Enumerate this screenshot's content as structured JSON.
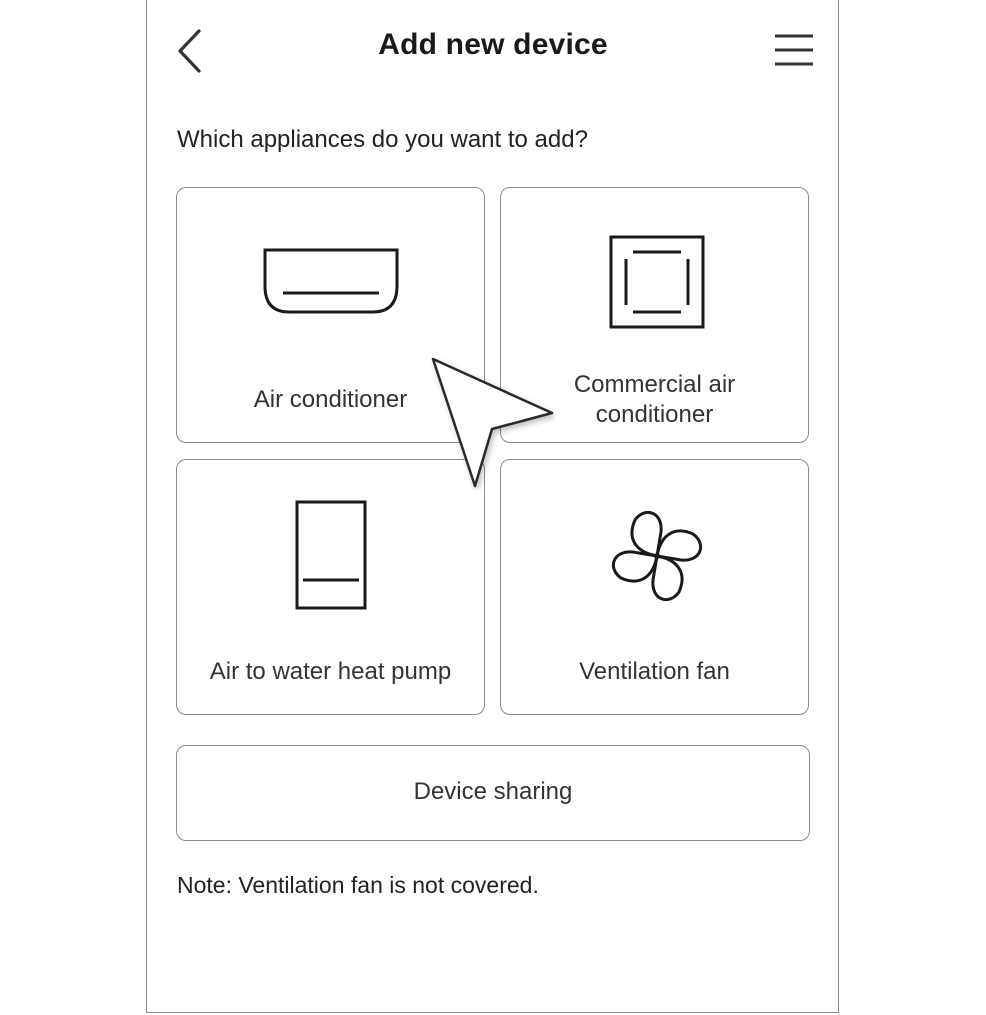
{
  "header": {
    "title": "Add new device",
    "back_icon": "chevron-left-icon",
    "menu_icon": "hamburger-menu-icon"
  },
  "question": "Which appliances do you want to add?",
  "appliances": [
    {
      "label": "Air conditioner",
      "icon": "wall-air-conditioner-icon"
    },
    {
      "label_line1": "Commercial air",
      "label_line2": "conditioner",
      "icon": "cassette-air-conditioner-icon"
    },
    {
      "label": "Air to water heat pump",
      "icon": "heat-pump-icon"
    },
    {
      "label": "Ventilation fan",
      "icon": "fan-icon"
    }
  ],
  "device_sharing_label": "Device sharing",
  "note": "Note: Ventilation fan is not covered.",
  "cursor_icon": "mouse-pointer-icon",
  "colors": {
    "border": "#8d8d8d",
    "text": "#2a2a2a",
    "icon_stroke": "#1a1a1a"
  }
}
